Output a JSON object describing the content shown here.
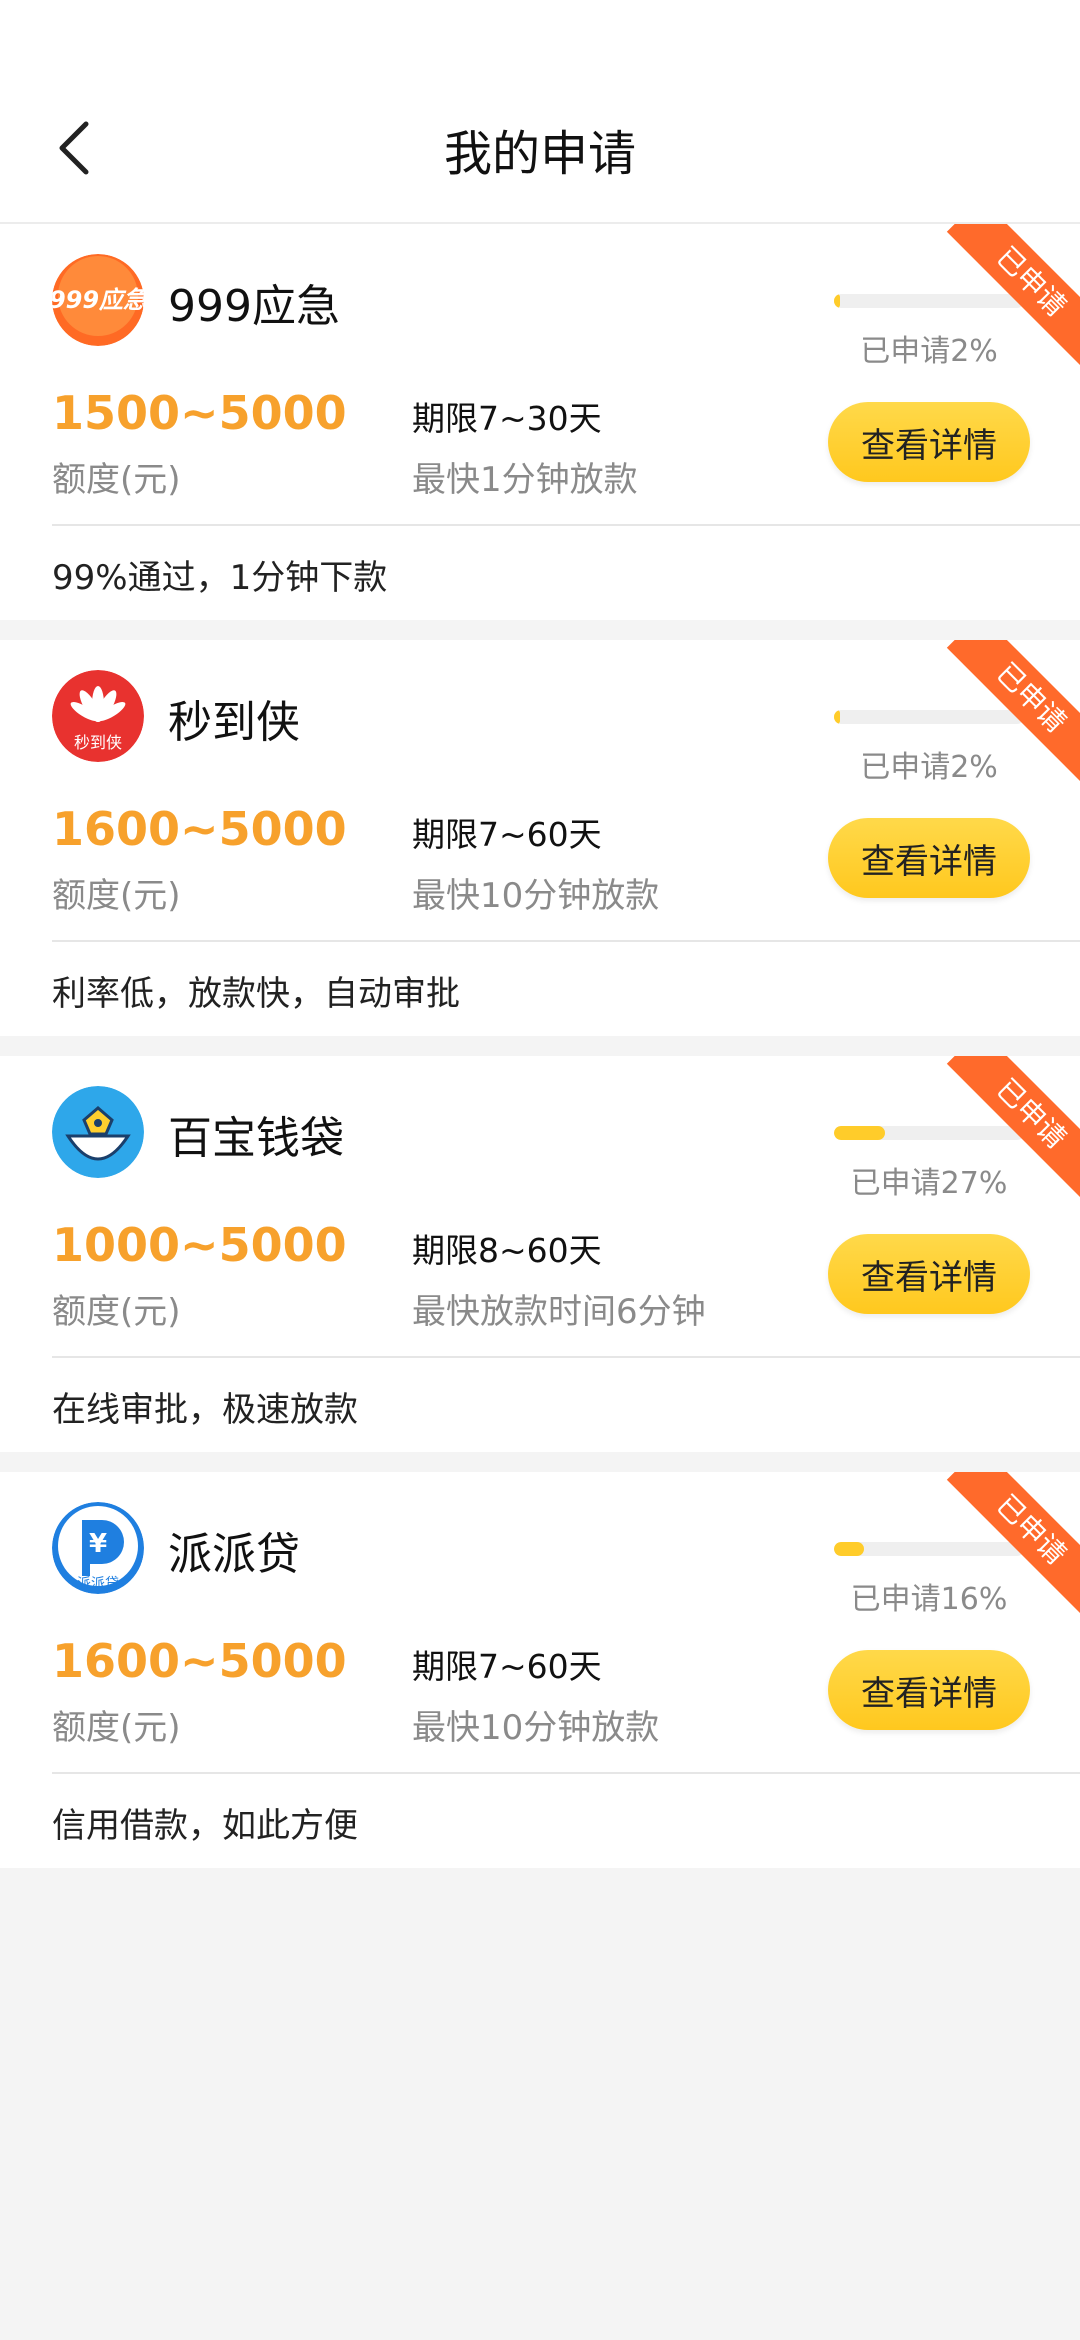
{
  "header": {
    "title": "我的申请",
    "back_icon": "chevron-left-icon"
  },
  "colors": {
    "accent_amount": "#f7a12c",
    "button_yellow": "#ffc81e",
    "ribbon_orange": "#ff6a2b",
    "progress_yellow": "#ffcc2a"
  },
  "items": [
    {
      "name": "999应急",
      "logo_text": "999应急",
      "logo_icon": "999-emergency-logo",
      "amount": "1500~5000",
      "amount_label": "额度(元)",
      "term": "期限7~30天",
      "speed": "最快1分钟放款",
      "progress_percent": 2,
      "progress_text": "已申请2%",
      "button_label": "查看详情",
      "tagline": "99%通过，1分钟下款",
      "ribbon": "已申请"
    },
    {
      "name": "秒到侠",
      "logo_text": "秒到侠",
      "logo_icon": "miaodaoxia-logo",
      "amount": "1600~5000",
      "amount_label": "额度(元)",
      "term": "期限7~60天",
      "speed": "最快10分钟放款",
      "progress_percent": 2,
      "progress_text": "已申请2%",
      "button_label": "查看详情",
      "tagline": "利率低，放款快，自动审批",
      "ribbon": "已申请"
    },
    {
      "name": "百宝钱袋",
      "logo_text": "",
      "logo_icon": "baibao-wallet-logo",
      "amount": "1000~5000",
      "amount_label": "额度(元)",
      "term": "期限8~60天",
      "speed": "最快放款时间6分钟",
      "progress_percent": 27,
      "progress_text": "已申请27%",
      "button_label": "查看详情",
      "tagline": "在线审批，极速放款",
      "ribbon": "已申请"
    },
    {
      "name": "派派贷",
      "logo_text": "派派贷",
      "logo_icon": "paipaidai-logo",
      "amount": "1600~5000",
      "amount_label": "额度(元)",
      "term": "期限7~60天",
      "speed": "最快10分钟放款",
      "progress_percent": 16,
      "progress_text": "已申请16%",
      "button_label": "查看详情",
      "tagline": "信用借款，如此方便",
      "ribbon": "已申请"
    }
  ]
}
